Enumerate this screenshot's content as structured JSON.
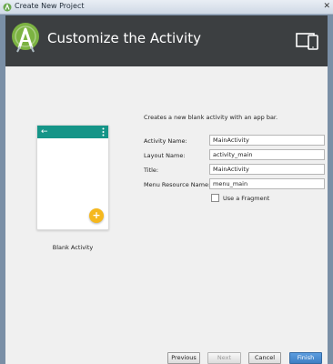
{
  "window": {
    "title": "Create New Project",
    "close_glyph": "✕"
  },
  "header": {
    "title": "Customize the Activity"
  },
  "template": {
    "name": "Blank Activity",
    "back_glyph": "←",
    "fab_glyph": "+"
  },
  "form": {
    "description": "Creates a new blank activity with an app bar.",
    "activity_name": {
      "label": "Activity Name:",
      "value": "MainActivity"
    },
    "layout_name": {
      "label": "Layout Name:",
      "value": "activity_main"
    },
    "title": {
      "label": "Title:",
      "value": "MainActivity"
    },
    "menu_resource_name": {
      "label": "Menu Resource Name:",
      "value": "menu_main"
    },
    "use_fragment": {
      "label": "Use a Fragment",
      "checked": false
    }
  },
  "buttons": {
    "previous": "Previous",
    "next": "Next",
    "cancel": "Cancel",
    "finish": "Finish"
  },
  "colors": {
    "app_bar": "#159588",
    "fab": "#f5b81e",
    "header_bg": "#3c3f41",
    "finish_button": "#3f7fc3"
  }
}
